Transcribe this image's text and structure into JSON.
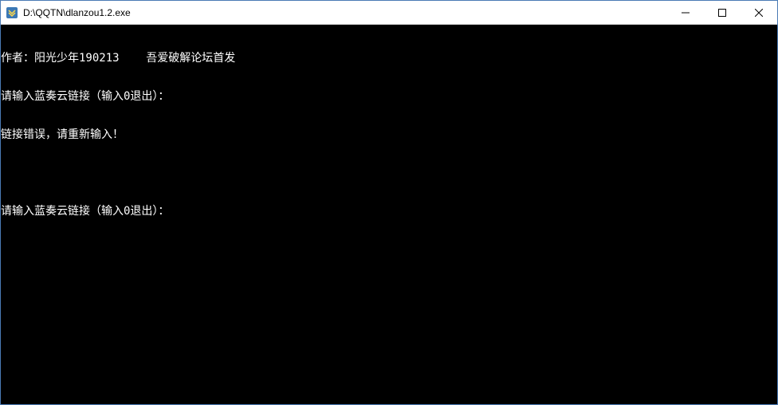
{
  "titlebar": {
    "title": "D:\\QQTN\\dlanzou1.2.exe"
  },
  "console": {
    "lines": [
      "作者：阳光少年190213    吾爱破解论坛首发",
      "请输入蓝奏云链接（输入0退出）：",
      "链接错误，请重新输入！",
      "",
      "请输入蓝奏云链接（输入0退出）："
    ]
  }
}
